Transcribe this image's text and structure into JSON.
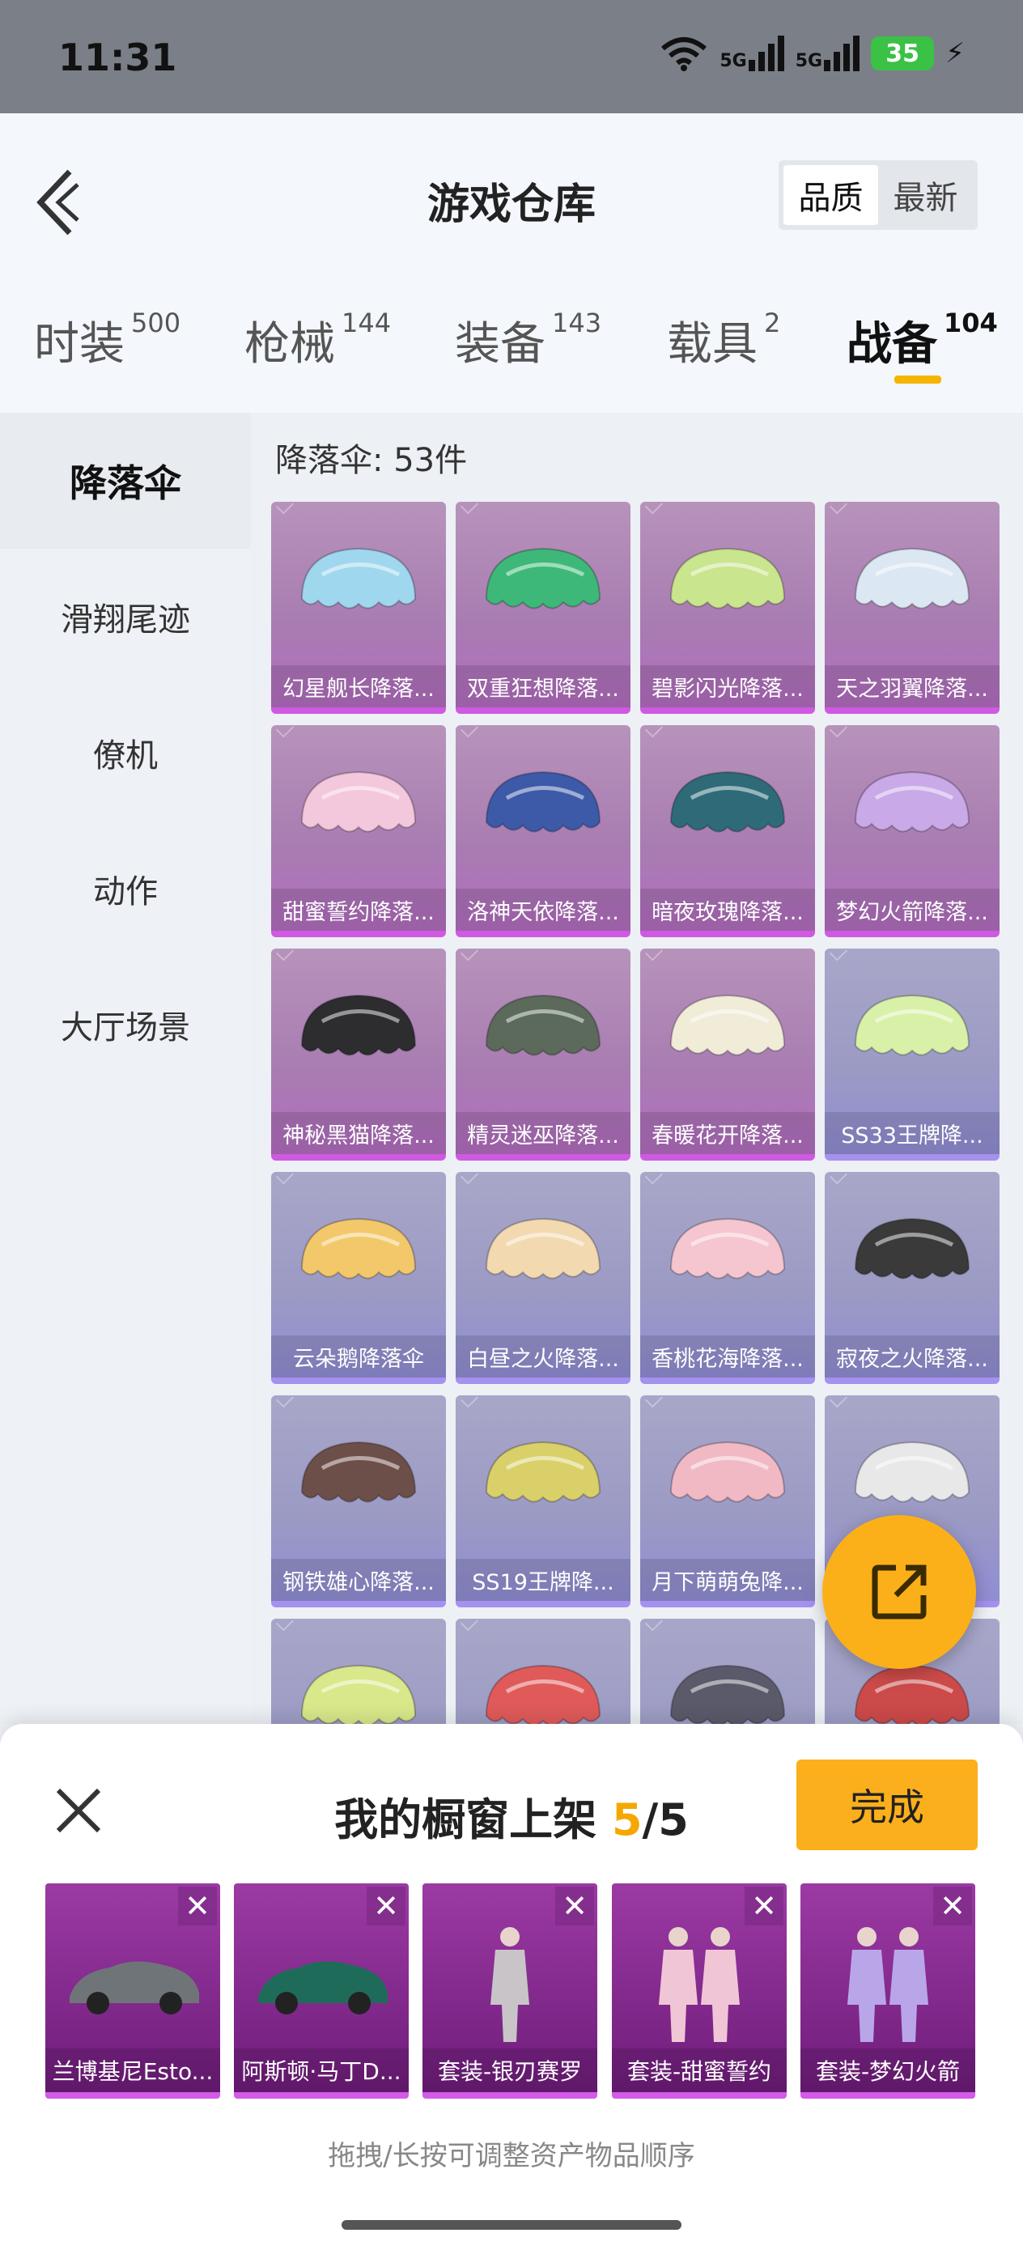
{
  "status": {
    "time": "11:31",
    "signal1": "5G",
    "signal2": "5G",
    "battery": "35",
    "charging_icon": "bolt-icon"
  },
  "header": {
    "title": "游戏仓库",
    "sort_options": [
      {
        "label": "品质",
        "active": true
      },
      {
        "label": "最新",
        "active": false
      }
    ]
  },
  "tabs": [
    {
      "label": "时装",
      "count": "500",
      "active": false
    },
    {
      "label": "枪械",
      "count": "144",
      "active": false
    },
    {
      "label": "装备",
      "count": "143",
      "active": false
    },
    {
      "label": "载具",
      "count": "2",
      "active": false
    },
    {
      "label": "战备",
      "count": "104",
      "active": true
    }
  ],
  "sidebar": {
    "items": [
      {
        "label": "降落伞",
        "active": true
      },
      {
        "label": "滑翔尾迹",
        "active": false
      },
      {
        "label": "僚机",
        "active": false
      },
      {
        "label": "动作",
        "active": false
      },
      {
        "label": "大厅场景",
        "active": false
      }
    ]
  },
  "grid": {
    "count_label": "降落伞: 53件",
    "items": [
      {
        "label": "幻星舰长降落...",
        "tier": "purple",
        "color": "#9fd7ee"
      },
      {
        "label": "双重狂想降落...",
        "tier": "purple",
        "color": "#3db879"
      },
      {
        "label": "碧影闪光降落...",
        "tier": "purple",
        "color": "#c9e58d"
      },
      {
        "label": "天之羽翼降落...",
        "tier": "purple",
        "color": "#dbe7f2"
      },
      {
        "label": "甜蜜誓约降落...",
        "tier": "purple",
        "color": "#f3c7dc"
      },
      {
        "label": "洛神天依降落...",
        "tier": "purple",
        "color": "#3c5aa8"
      },
      {
        "label": "暗夜玫瑰降落...",
        "tier": "purple",
        "color": "#2f6a78"
      },
      {
        "label": "梦幻火箭降落...",
        "tier": "purple",
        "color": "#c9a9e8"
      },
      {
        "label": "神秘黑猫降落...",
        "tier": "purple",
        "color": "#2d2d30"
      },
      {
        "label": "精灵迷巫降落...",
        "tier": "purple",
        "color": "#5b6a5a"
      },
      {
        "label": "春暖花开降落...",
        "tier": "purple",
        "color": "#f1ecd8"
      },
      {
        "label": "SS33王牌降...",
        "tier": "blue",
        "color": "#d8f0a8"
      },
      {
        "label": "云朵鹅降落伞",
        "tier": "blue",
        "color": "#f2c86a"
      },
      {
        "label": "白昼之火降落...",
        "tier": "blue",
        "color": "#f3d9b0"
      },
      {
        "label": "香桃花海降落...",
        "tier": "blue",
        "color": "#f5c6cf"
      },
      {
        "label": "寂夜之火降落...",
        "tier": "blue",
        "color": "#3a3a3a"
      },
      {
        "label": "钢铁雄心降落...",
        "tier": "blue",
        "color": "#6d4f4a"
      },
      {
        "label": "SS19王牌降...",
        "tier": "blue",
        "color": "#d9d06a"
      },
      {
        "label": "月下萌萌兔降...",
        "tier": "blue",
        "color": "#f0b9c4"
      },
      {
        "label": "",
        "tier": "blue",
        "color": "#e8e8e8"
      },
      {
        "label": "",
        "tier": "blue",
        "color": "#d8e88a"
      },
      {
        "label": "",
        "tier": "blue",
        "color": "#e05a5a"
      },
      {
        "label": "",
        "tier": "blue",
        "color": "#5a5a6a"
      },
      {
        "label": "",
        "tier": "blue",
        "color": "#cc4a4a"
      }
    ]
  },
  "fab": {
    "icon": "share-external-icon"
  },
  "showcase": {
    "title_prefix": "我的橱窗上架 ",
    "current": "5",
    "total_suffix": "/5",
    "done_label": "完成",
    "items": [
      {
        "label": "兰博基尼Esto...",
        "kind": "car",
        "color": "#6f7478"
      },
      {
        "label": "阿斯顿·马丁D...",
        "kind": "car",
        "color": "#1f6b5a"
      },
      {
        "label": "套装-银刃赛罗",
        "kind": "suit",
        "color": "#c9c4c8"
      },
      {
        "label": "套装-甜蜜誓约",
        "kind": "duo",
        "color": "#f0c6d6"
      },
      {
        "label": "套装-梦幻火箭",
        "kind": "duo",
        "color": "#b9a6e8"
      }
    ],
    "hint": "拖拽/长按可调整资产物品顺序"
  }
}
